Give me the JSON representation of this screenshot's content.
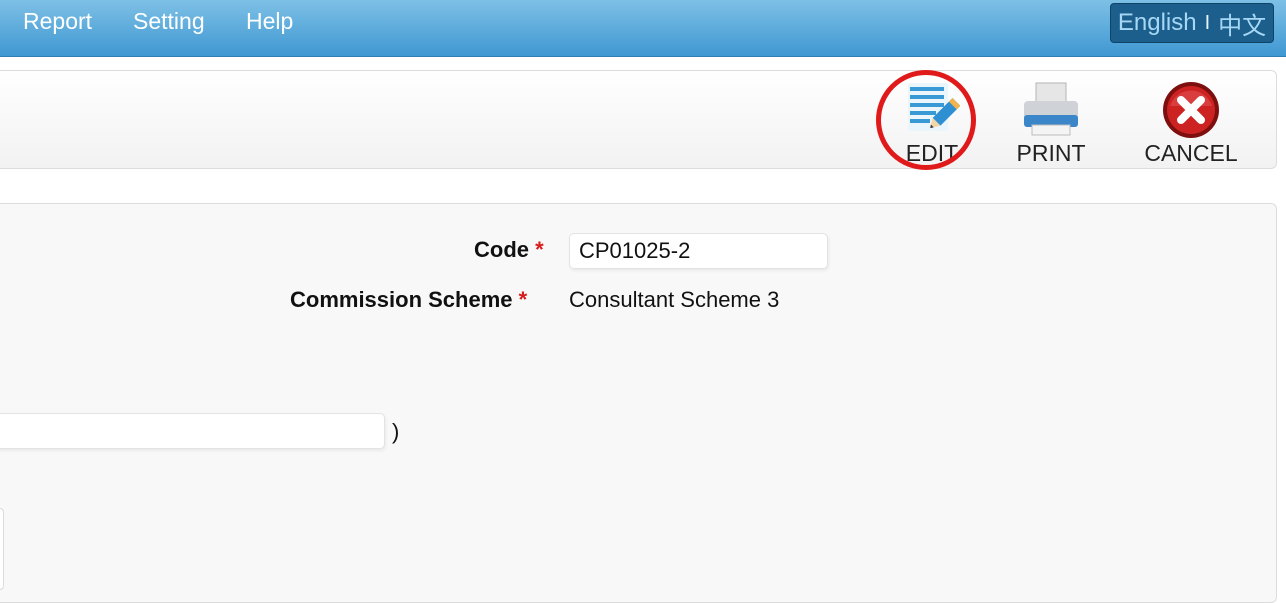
{
  "nav": {
    "items": [
      "Report",
      "Setting",
      "Help"
    ],
    "lang_english": "English",
    "lang_separator": "I",
    "lang_chinese": "中文"
  },
  "toolbar": {
    "edit_label": "EDIT",
    "print_label": "PRINT",
    "cancel_label": "CANCEL"
  },
  "form": {
    "code_label": "Code",
    "code_value": "CP01025-2",
    "scheme_label": "Commission Scheme",
    "scheme_value": "Consultant Scheme 3",
    "required_marker": "*",
    "extra_field_value": "",
    "paren": ")"
  },
  "colors": {
    "nav_bg": "#4fa5d9",
    "required": "#d81b1b",
    "highlight": "#e01a1a"
  },
  "icons": [
    "edit-icon",
    "printer-icon",
    "cancel-icon"
  ]
}
